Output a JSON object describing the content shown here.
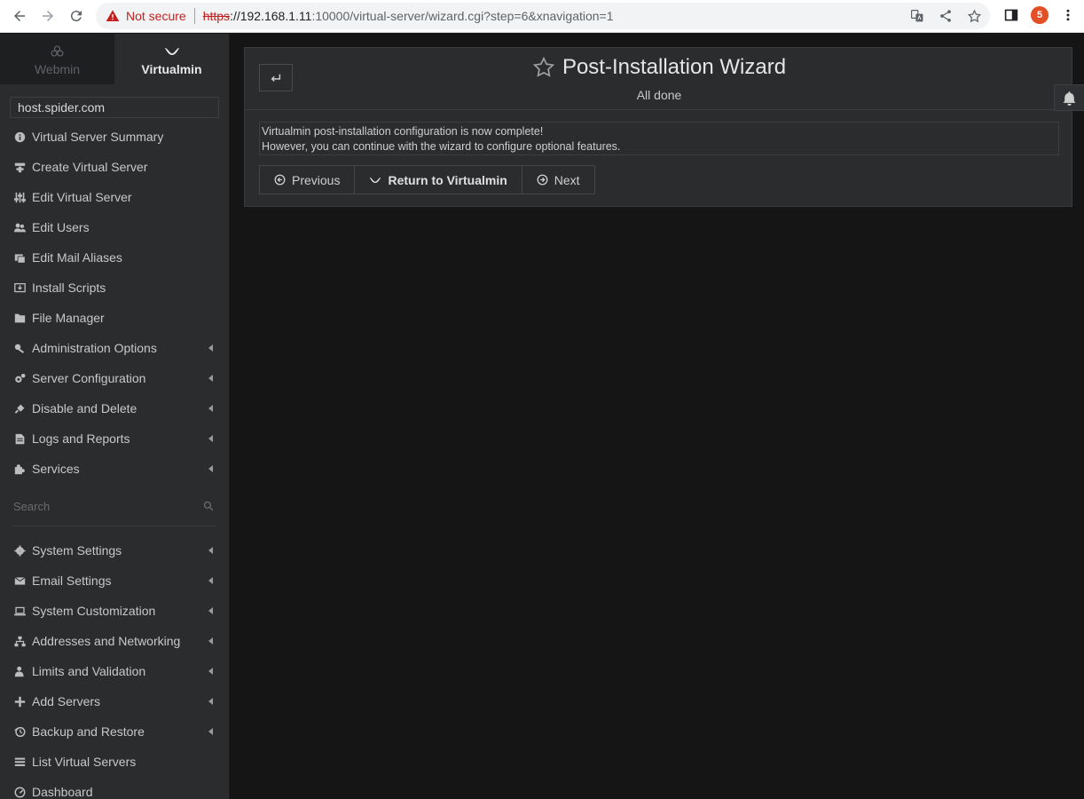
{
  "browser": {
    "security_label": "Not secure",
    "url_scheme": "https",
    "url_host": "://192.168.1.11",
    "url_path": ":10000/virtual-server/wizard.cgi?step=6&xnavigation=1"
  },
  "switcher": {
    "webmin_label": "Webmin",
    "virtualmin_label": "Virtualmin"
  },
  "sidebar": {
    "domain": "host.spider.com",
    "items": [
      {
        "label": "Virtual Server Summary",
        "icon": "info-icon",
        "submenu": false
      },
      {
        "label": "Create Virtual Server",
        "icon": "create-server-icon",
        "submenu": false
      },
      {
        "label": "Edit Virtual Server",
        "icon": "sliders-icon",
        "submenu": false
      },
      {
        "label": "Edit Users",
        "icon": "users-icon",
        "submenu": false
      },
      {
        "label": "Edit Mail Aliases",
        "icon": "mail-alias-icon",
        "submenu": false
      },
      {
        "label": "Install Scripts",
        "icon": "install-icon",
        "submenu": false
      },
      {
        "label": "File Manager",
        "icon": "folder-icon",
        "submenu": false
      },
      {
        "label": "Administration Options",
        "icon": "key-icon",
        "submenu": true
      },
      {
        "label": "Server Configuration",
        "icon": "cogs-icon",
        "submenu": true
      },
      {
        "label": "Disable and Delete",
        "icon": "plug-icon",
        "submenu": true
      },
      {
        "label": "Logs and Reports",
        "icon": "file-icon",
        "submenu": true
      },
      {
        "label": "Services",
        "icon": "puzzle-icon",
        "submenu": true
      }
    ],
    "search_placeholder": "Search",
    "items2": [
      {
        "label": "System Settings",
        "icon": "gear-icon",
        "submenu": true
      },
      {
        "label": "Email Settings",
        "icon": "envelope-icon",
        "submenu": true
      },
      {
        "label": "System Customization",
        "icon": "laptop-icon",
        "submenu": true
      },
      {
        "label": "Addresses and Networking",
        "icon": "network-icon",
        "submenu": true
      },
      {
        "label": "Limits and Validation",
        "icon": "user-limit-icon",
        "submenu": true
      },
      {
        "label": "Add Servers",
        "icon": "plus-icon",
        "submenu": true
      },
      {
        "label": "Backup and Restore",
        "icon": "history-icon",
        "submenu": true
      },
      {
        "label": "List Virtual Servers",
        "icon": "list-icon",
        "submenu": false
      },
      {
        "label": "Dashboard",
        "icon": "dashboard-icon",
        "submenu": false
      }
    ]
  },
  "page": {
    "title": "Post-Installation Wizard",
    "subtitle": "All done",
    "message_line1": "Virtualmin post-installation configuration is now complete!",
    "message_line2": "However, you can continue with the wizard to configure optional features.",
    "buttons": {
      "previous": "Previous",
      "return": "Return to Virtualmin",
      "next": "Next"
    }
  }
}
